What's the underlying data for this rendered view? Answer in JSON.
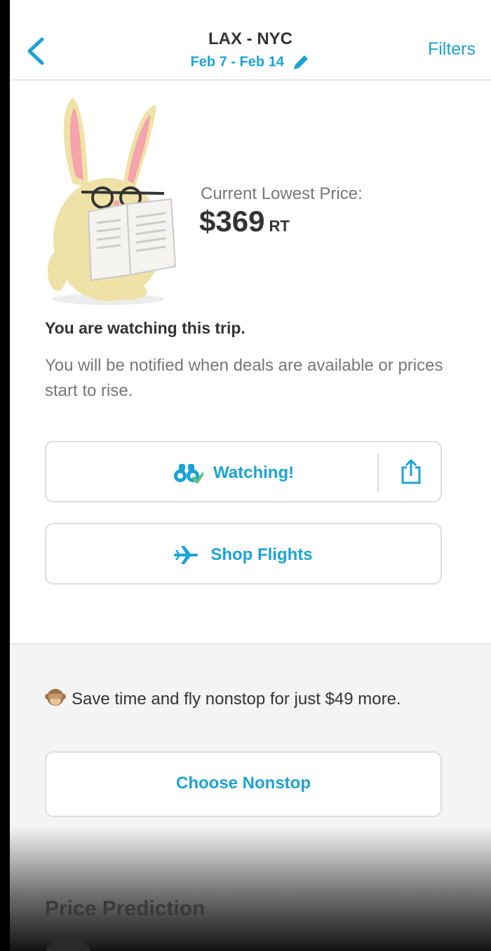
{
  "header": {
    "route": "LAX - NYC",
    "dates": "Feb 7 - Feb 14",
    "filters_label": "Filters"
  },
  "price": {
    "label": "Current Lowest Price:",
    "value": "$369",
    "unit": "RT"
  },
  "watch": {
    "title": "You are watching this trip.",
    "description": "You will be notified when deals are available or prices start to rise.",
    "button_label": "Watching!"
  },
  "shop": {
    "button_label": "Shop Flights"
  },
  "nonstop": {
    "message": "Save time and fly nonstop for just $49 more.",
    "button_label": "Choose Nonstop"
  },
  "prediction": {
    "title": "Price Prediction"
  },
  "colors": {
    "accent": "#1ba3d6",
    "text_dark": "#333333",
    "text_muted": "#777777"
  },
  "icons": [
    "back-chevron-icon",
    "pencil-icon",
    "rabbit-illustration",
    "binoculars-icon",
    "share-icon",
    "airplane-icon",
    "see-no-evil-monkey-icon"
  ]
}
